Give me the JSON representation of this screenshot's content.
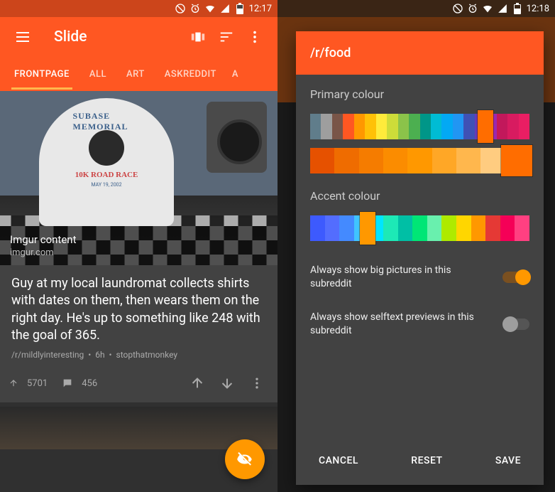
{
  "left": {
    "status_time": "12:17",
    "appbar": {
      "title": "Slide",
      "accent": "#ff5722"
    },
    "tabs": [
      "FRONTPAGE",
      "ALL",
      "ART",
      "ASKREDDIT",
      "A"
    ],
    "active_tab": 0,
    "post": {
      "shirt_top": "SUBASE MEMORIAL",
      "shirt_mid": "10K ROAD RACE",
      "shirt_date": "MAY 19, 2002",
      "overlay_title": "Imgur content",
      "overlay_domain": "imgur.com",
      "title": "Guy at my local laundromat collects shirts with dates on them, then wears them on the right day. He's up to something like 248 with the goal of 365.",
      "subreddit": "/r/mildlyinteresting",
      "age": "6h",
      "author": "stopthatmonkey",
      "score": "5701",
      "comments": "456"
    }
  },
  "right": {
    "status_time": "12:18",
    "dialog": {
      "title": "/r/food",
      "accent": "#ff5722",
      "primary_label": "Primary colour",
      "accent_label": "Accent colour",
      "primary_row1": [
        "#e91e63",
        "#d81b60",
        "#c2185b",
        "#9c27b0",
        "#673ab7",
        "#3f51b5",
        "#2196f3",
        "#03a9f4",
        "#00bcd4",
        "#009688",
        "#4caf50",
        "#8bc34a",
        "#cddc39",
        "#ffeb3b",
        "#ffc107",
        "#ff9800",
        "#ff5722",
        "#795548",
        "#9e9e9e",
        "#607d8b"
      ],
      "primary_row2": [
        "#ffe0b2",
        "#ffcc80",
        "#ffb74d",
        "#ffa726",
        "#ff9800",
        "#fb8c00",
        "#f57c00",
        "#ef6c00",
        "#e65100"
      ],
      "accent_row": [
        "#ff4081",
        "#f50057",
        "#e53935",
        "#ff9800",
        "#ffd600",
        "#aeea00",
        "#69f0ae",
        "#00e676",
        "#00bfa5",
        "#1de9b6",
        "#00e5ff",
        "#40c4ff",
        "#448aff",
        "#536dfe",
        "#3d5afe"
      ],
      "toggle1": "Always show big pictures in this subreddit",
      "toggle1_on": true,
      "toggle2": "Always show selftext previews in this subreddit",
      "toggle2_on": false,
      "btn_cancel": "CANCEL",
      "btn_reset": "RESET",
      "btn_save": "SAVE"
    }
  }
}
